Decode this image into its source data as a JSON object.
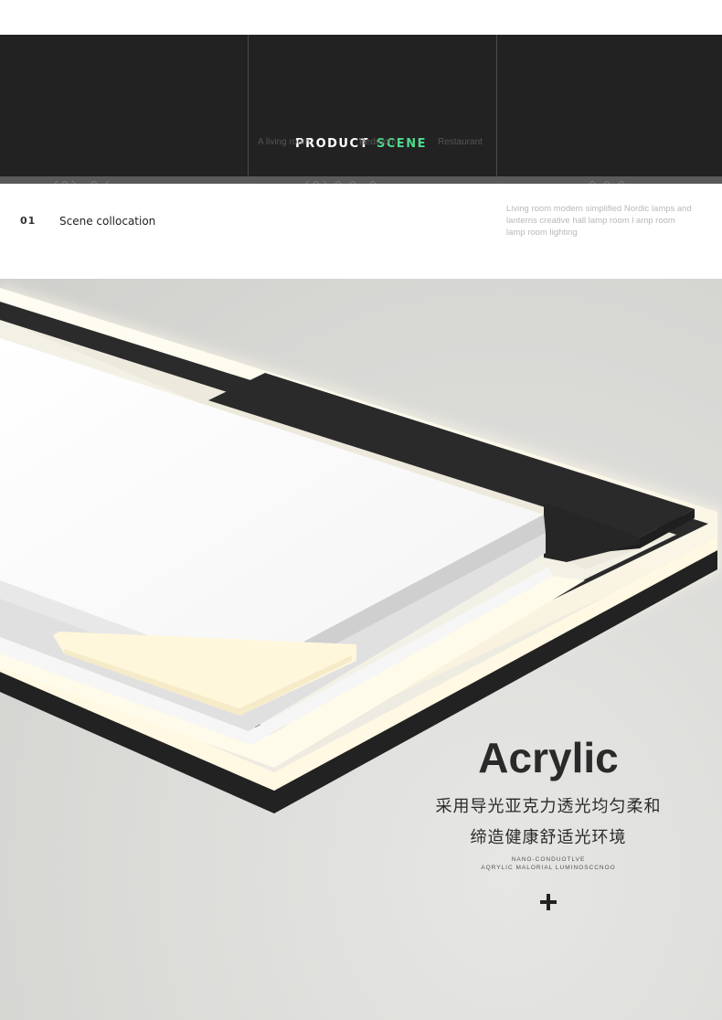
{
  "banner": {
    "title_word1": "PRODUCT",
    "title_word2": "SCENE",
    "tabs": [
      "A living room",
      "Bedroom",
      "Restaurant"
    ],
    "accent_color": "#4fd98d"
  },
  "scene": {
    "number": "01",
    "title": "Scene collocation",
    "description": "Living room modern simplified Nordic lamps and lanterns creative hall lamp room l amp room lamp room lighting"
  },
  "feature": {
    "headline": "Acrylic",
    "cn_line1": "采用导光亚克力透光均匀柔和",
    "cn_line2": "缔造健康舒适光环境",
    "sub_line1": "NANO-CONDUOTLVE",
    "sub_line2": "AQRYLIC MALORIAL LUMINOSCCNOO",
    "icon": "plus-icon"
  }
}
